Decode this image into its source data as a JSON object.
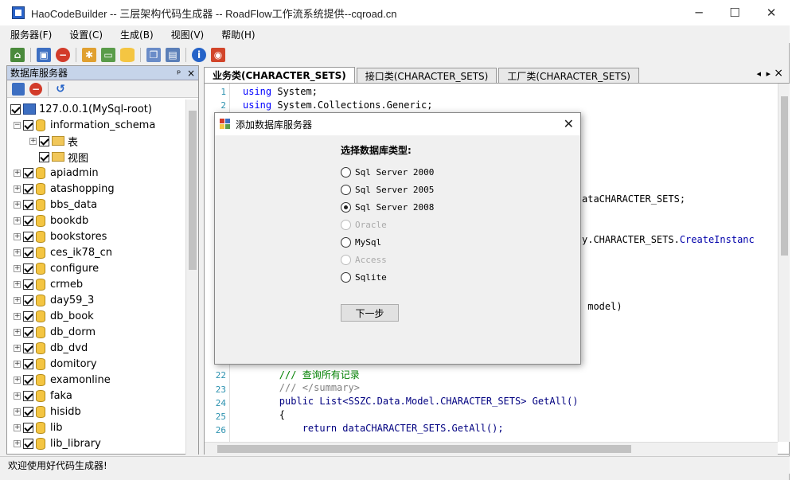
{
  "window": {
    "title": "HaoCodeBuilder -- 三层架构代码生成器 -- RoadFlow工作流系统提供--cqroad.cn"
  },
  "menu": [
    "服务器(F)",
    "设置(C)",
    "生成(B)",
    "视图(V)",
    "帮助(H)"
  ],
  "toolbar_icons": [
    "home-icon",
    "server-connect-icon",
    "add-server-icon",
    "stop-icon",
    "tools-icon",
    "image-icon",
    "database-icon",
    "copy-icon",
    "window-icon",
    "info-icon",
    "exit-icon"
  ],
  "left_panel": {
    "title": "数据库服务器",
    "pin": "ᵖ",
    "close": "×",
    "root": "127.0.0.1(MySql-root)",
    "schema": "information_schema",
    "schema_children": [
      "表",
      "视图"
    ],
    "databases": [
      "apiadmin",
      "atashopping",
      "bbs_data",
      "bookdb",
      "bookstores",
      "ces_ik78_cn",
      "configure",
      "crmeb",
      "day59_3",
      "db_book",
      "db_dorm",
      "db_dvd",
      "domitory",
      "examonline",
      "faka",
      "hisidb",
      "lib",
      "lib_library"
    ]
  },
  "tabs": [
    "业务类(CHARACTER_SETS)",
    "接口类(CHARACTER_SETS)",
    "工厂类(CHARACTER_SETS)"
  ],
  "tab_controls": {
    "left": "◂",
    "right": "▸",
    "close": "×"
  },
  "code": {
    "top": [
      {
        "n": "1",
        "kw": "using",
        "rest": " System;"
      },
      {
        "n": "2",
        "kw": "using",
        "rest": " System.Collections.Generic;"
      }
    ],
    "fragments": [
      "ataCHARACTER_SETS;",
      "y.CHARACTER_SETS.",
      "CreateInstanc",
      " model)"
    ],
    "bottom": [
      {
        "n": "22",
        "text": "        /// 查询所有记录"
      },
      {
        "n": "23",
        "text": "        /// </summary>"
      },
      {
        "n": "24",
        "text": "        public List<SSZC.Data.Model.CHARACTER_SETS> GetAll()"
      },
      {
        "n": "25",
        "text": "        {"
      },
      {
        "n": "26",
        "text": "            return dataCHARACTER_SETS.GetAll();"
      }
    ]
  },
  "dialog": {
    "title": "添加数据库服务器",
    "label": "选择数据库类型:",
    "options": [
      {
        "label": "Sql Server 2000",
        "selected": false,
        "disabled": false
      },
      {
        "label": "Sql Server 2005",
        "selected": false,
        "disabled": false
      },
      {
        "label": "Sql Server 2008",
        "selected": true,
        "disabled": false
      },
      {
        "label": "Oracle",
        "selected": false,
        "disabled": true
      },
      {
        "label": "MySql",
        "selected": false,
        "disabled": false
      },
      {
        "label": "Access",
        "selected": false,
        "disabled": true
      },
      {
        "label": "Sqlite",
        "selected": false,
        "disabled": false
      }
    ],
    "next_button": "下一步"
  },
  "status": "欢迎使用好代码生成器!"
}
